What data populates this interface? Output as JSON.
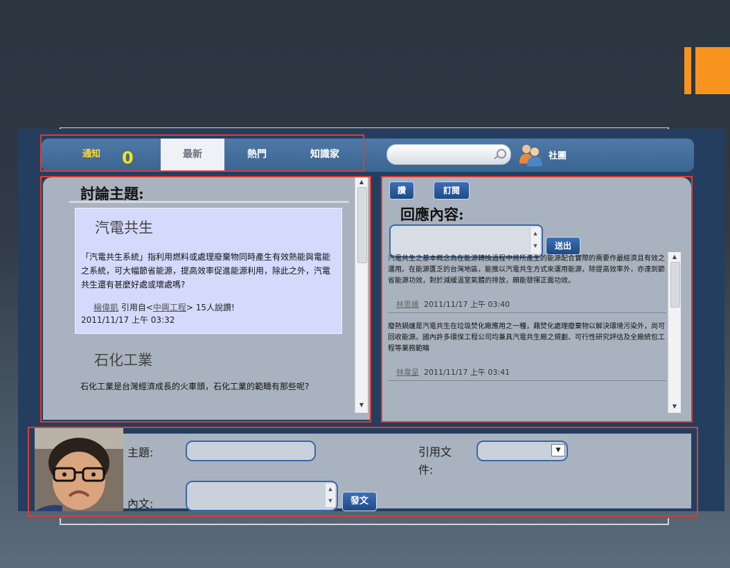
{
  "nav": {
    "notify_label": "通知",
    "notify_count": "0",
    "tab_latest": "最新",
    "tab_hot": "熱門",
    "tab_expert": "知識家",
    "search_placeholder": "",
    "community_label": "社團"
  },
  "discussion": {
    "heading": "討論主題:",
    "topics": [
      {
        "title": "汽電共生",
        "body": "「汽電共生系統」指利用燃料或處理廢棄物同時產生有效熱能與電能之系統，可大幅節省能源，提高效率促進能源利用，除此之外，汽電共生還有甚麼好處或壞處嗎?",
        "author": "楊偉凱",
        "cite_prefix": "引用自<",
        "cite_source": "中興工程",
        "cite_suffix": "> 15人說讚!",
        "time": "2011/11/17 上午 03:32"
      },
      {
        "title": "石化工業",
        "body": "石化工業是台灣經濟成長的火車頭，石化工業的範疇有那些呢?"
      }
    ]
  },
  "reply": {
    "like_button": "讚",
    "subscribe_button": "訂閱",
    "heading": "回應內容:",
    "send_button": "送出",
    "items": [
      {
        "text": "汽電共生之基本概念為在能源轉換過程中將所產生的能源配合實際的需要作最經濟且有效之運用。在能源匱乏的台灣地區，能推以汽電共生方式來運用能源，除提高效率外，亦達到節省能源功效，對於減緩溫室氣體的排放，頗能發揮正面功效。",
        "author": "林思維",
        "time": "2011/11/17 上午 03:40"
      },
      {
        "text": "廢熱鍋爐是汽電共生在垃圾焚化廠應用之一種，藉焚化處理廢棄物以解決環境污染外，尚可回收能源。國內許多環保工程公司均兼具汽電共生廠之規劃、可行性研究評估及全廠統包工程等業務範疇",
        "author": "林韋呈",
        "time": "2011/11/17 上午 03:41"
      }
    ]
  },
  "compose": {
    "subject_label": "主題:",
    "cite_label": "引用文件:",
    "body_label": "內文:",
    "post_button": "發文"
  },
  "colors": {
    "accent": "#f7941d",
    "frame": "#243e60",
    "panel": "#a9b3bf",
    "button": "#1f4b86",
    "annotation": "#e23b2e"
  }
}
